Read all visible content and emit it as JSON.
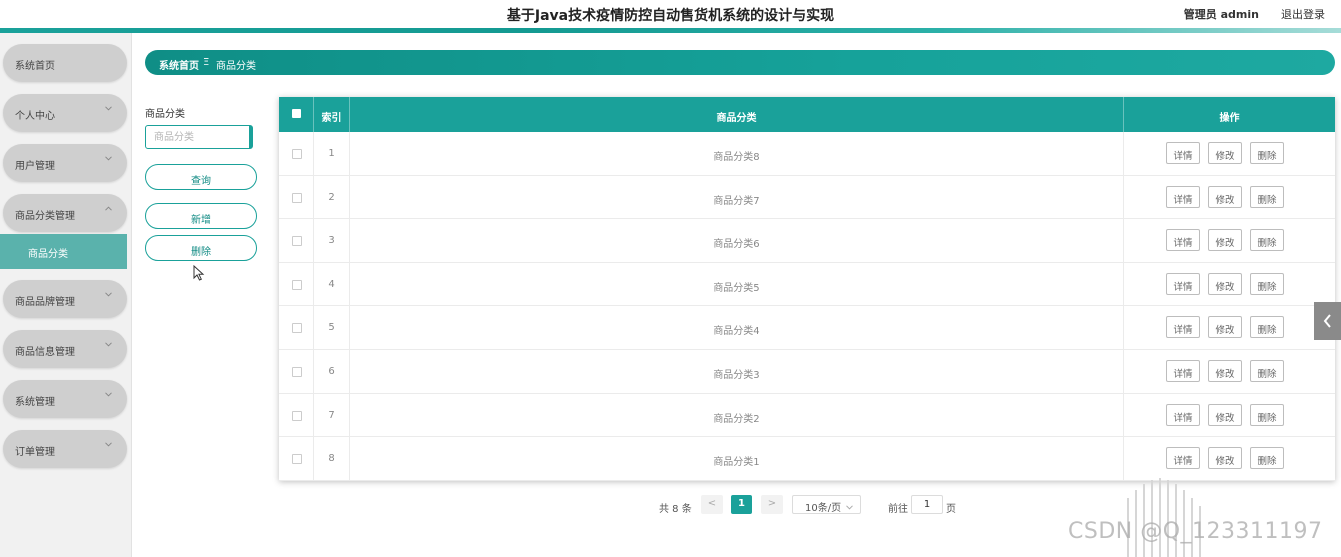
{
  "header": {
    "title": "基于Java技术疫情防控自动售货机系统的设计与实现",
    "user": "管理员 admin",
    "logout": "退出登录"
  },
  "sidebar": {
    "items": [
      {
        "label": "系统首页"
      },
      {
        "label": "个人中心"
      },
      {
        "label": "用户管理"
      },
      {
        "label": "商品分类管理"
      },
      {
        "label": "商品品牌管理"
      },
      {
        "label": "商品信息管理"
      },
      {
        "label": "系统管理"
      },
      {
        "label": "订单管理"
      }
    ],
    "sub_item": "商品分类"
  },
  "breadcrumb": {
    "home": "系统首页",
    "separator": "Ξ",
    "current": "商品分类"
  },
  "search": {
    "label": "商品分类",
    "placeholder": "商品分类",
    "query_button": "查询",
    "add_button": "新增",
    "delete_button": "删除"
  },
  "table": {
    "columns": {
      "index": "索引",
      "category": "商品分类",
      "actions": "操作"
    },
    "rows": [
      {
        "index": "1",
        "category": "商品分类8"
      },
      {
        "index": "2",
        "category": "商品分类7"
      },
      {
        "index": "3",
        "category": "商品分类6"
      },
      {
        "index": "4",
        "category": "商品分类5"
      },
      {
        "index": "5",
        "category": "商品分类4"
      },
      {
        "index": "6",
        "category": "商品分类3"
      },
      {
        "index": "7",
        "category": "商品分类2"
      },
      {
        "index": "8",
        "category": "商品分类1"
      }
    ],
    "row_actions": {
      "detail": "详情",
      "edit": "修改",
      "delete": "删除"
    }
  },
  "pagination": {
    "total": "共 8 条",
    "prev": "<",
    "current_page": "1",
    "next": ">",
    "page_size": "10条/页",
    "goto_label": "前往",
    "goto_value": "1",
    "page_suffix": "页"
  },
  "watermark": "CSDN @Q_123311197",
  "colors": {
    "accent": "#1aa19a",
    "submenu": "#5ab2ac",
    "menu": "#cfcfcf"
  }
}
